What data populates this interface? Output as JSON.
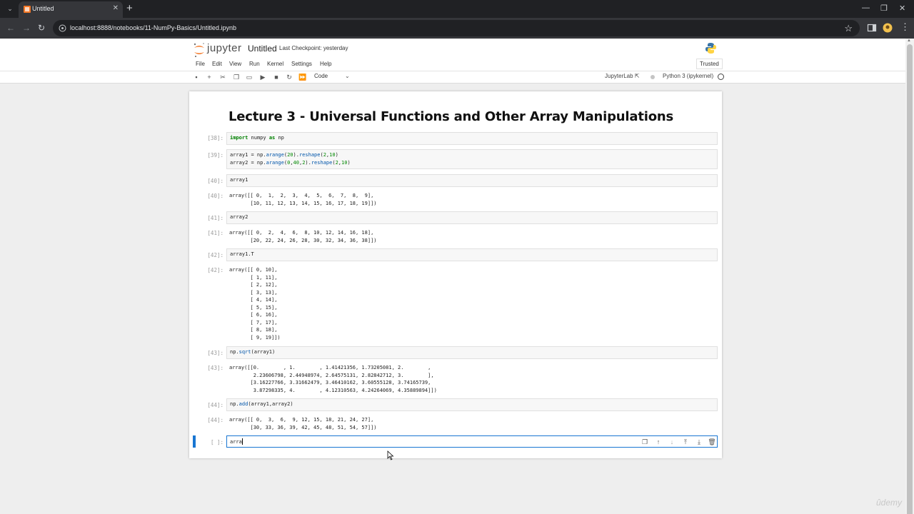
{
  "browser": {
    "tab_title": "Untitled",
    "url": "localhost:8888/notebooks/11-NumPy-Basics/Untitled.ipynb",
    "accent": "#202124"
  },
  "jupyter": {
    "logo_text": "jupyter",
    "notebook_title": "Untitled",
    "checkpoint": "Last Checkpoint: yesterday",
    "trusted": "Trusted",
    "menus": [
      "File",
      "Edit",
      "View",
      "Run",
      "Kernel",
      "Settings",
      "Help"
    ],
    "cell_type": "Code",
    "jupyterlab_link": "JupyterLab",
    "kernel": "Python 3 (ipykernel)"
  },
  "notebook": {
    "heading": "Lecture 3 - Universal Functions and Other Array Manipulations",
    "cells": [
      {
        "prompt": "[38]:",
        "code": [
          "import numpy as np"
        ]
      },
      {
        "prompt": "[39]:",
        "code": [
          "array1 = np.arange(20).reshape(2,10)",
          "array2 = np.arange(0,40,2).reshape(2,10)"
        ]
      },
      {
        "prompt": "[40]:",
        "code": [
          "array1"
        ],
        "out_prompt": "[40]:",
        "output": [
          "array([[ 0,  1,  2,  3,  4,  5,  6,  7,  8,  9],",
          "       [10, 11, 12, 13, 14, 15, 16, 17, 18, 19]])"
        ]
      },
      {
        "prompt": "[41]:",
        "code": [
          "array2"
        ],
        "out_prompt": "[41]:",
        "output": [
          "array([[ 0,  2,  4,  6,  8, 10, 12, 14, 16, 18],",
          "       [20, 22, 24, 26, 28, 30, 32, 34, 36, 38]])"
        ]
      },
      {
        "prompt": "[42]:",
        "code": [
          "array1.T"
        ],
        "out_prompt": "[42]:",
        "output": [
          "array([[ 0, 10],",
          "       [ 1, 11],",
          "       [ 2, 12],",
          "       [ 3, 13],",
          "       [ 4, 14],",
          "       [ 5, 15],",
          "       [ 6, 16],",
          "       [ 7, 17],",
          "       [ 8, 18],",
          "       [ 9, 19]])"
        ]
      },
      {
        "prompt": "[43]:",
        "code": [
          "np.sqrt(array1)"
        ],
        "out_prompt": "[43]:",
        "output": [
          "array([[0.        , 1.        , 1.41421356, 1.73205081, 2.        ,",
          "        2.23606798, 2.44948974, 2.64575131, 2.82842712, 3.        ],",
          "       [3.16227766, 3.31662479, 3.46410162, 3.60555128, 3.74165739,",
          "        3.87298335, 4.        , 4.12310563, 4.24264069, 4.35889894]])"
        ]
      },
      {
        "prompt": "[44]:",
        "code": [
          "np.add(array1,array2)"
        ],
        "out_prompt": "[44]:",
        "output": [
          "array([[ 0,  3,  6,  9, 12, 15, 18, 21, 24, 27],",
          "       [30, 33, 36, 39, 42, 45, 48, 51, 54, 57]])"
        ]
      }
    ],
    "active_cell": {
      "prompt": "[ ]:",
      "code": "arra"
    }
  },
  "watermark": "ûdemy"
}
